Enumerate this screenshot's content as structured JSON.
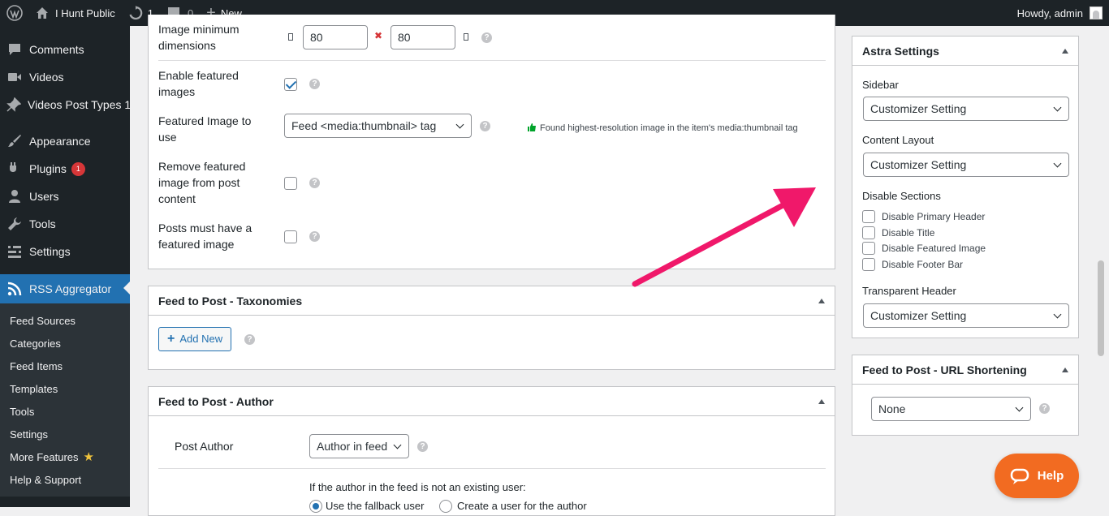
{
  "adminbar": {
    "site_name": "I Hunt Public",
    "updates_count": "1",
    "comments_count": "0",
    "new_label": "New",
    "howdy": "Howdy, admin"
  },
  "sidebar": {
    "items": [
      {
        "label": "Comments",
        "icon": "comment-icon"
      },
      {
        "label": "Videos",
        "icon": "video-icon"
      },
      {
        "label": "Videos Post Types 1",
        "icon": "pin-icon"
      },
      {
        "label": "Appearance",
        "icon": "brush-icon"
      },
      {
        "label": "Plugins",
        "icon": "plugin-icon",
        "badge": "1"
      },
      {
        "label": "Users",
        "icon": "user-icon"
      },
      {
        "label": "Tools",
        "icon": "wrench-icon"
      },
      {
        "label": "Settings",
        "icon": "settings-icon"
      },
      {
        "label": "RSS Aggregator",
        "icon": "rss-icon",
        "current": true
      }
    ],
    "submenu": [
      {
        "label": "Feed Sources"
      },
      {
        "label": "Categories"
      },
      {
        "label": "Feed Items"
      },
      {
        "label": "Templates"
      },
      {
        "label": "Tools"
      },
      {
        "label": "Settings"
      },
      {
        "label": "More Features",
        "star": "★"
      },
      {
        "label": "Help & Support"
      }
    ]
  },
  "images_panel": {
    "min_dims_label": "Image minimum dimensions",
    "min_width": "80",
    "times": "✖",
    "min_height": "80",
    "enable_featured_label": "Enable featured images",
    "enable_featured_checked": true,
    "featured_to_use_label": "Featured Image to use",
    "featured_to_use_value": "Feed <media:thumbnail> tag",
    "featured_note": "Found highest-resolution image in the item's media:thumbnail tag",
    "remove_featured_label": "Remove featured image from post content",
    "must_have_label": "Posts must have a featured image",
    "help_glyph": "?"
  },
  "taxonomies_panel": {
    "title": "Feed to Post - Taxonomies",
    "add_new": "Add New",
    "plus": "+"
  },
  "author_panel": {
    "title": "Feed to Post - Author",
    "post_author_label": "Post Author",
    "post_author_value": "Author in feed",
    "fallback_question": "If the author in the feed is not an existing user:",
    "radio_fallback": "Use the fallback user",
    "radio_create": "Create a user for the author"
  },
  "astra": {
    "title": "Astra Settings",
    "sidebar_label": "Sidebar",
    "sidebar_value": "Customizer Setting",
    "content_layout_label": "Content Layout",
    "content_layout_value": "Customizer Setting",
    "disable_sections_label": "Disable Sections",
    "sections": [
      {
        "label": "Disable Primary Header"
      },
      {
        "label": "Disable Title"
      },
      {
        "label": "Disable Featured Image"
      },
      {
        "label": "Disable Footer Bar"
      }
    ],
    "transparent_header_label": "Transparent Header",
    "transparent_header_value": "Customizer Setting"
  },
  "url_shortening": {
    "title": "Feed to Post - URL Shortening",
    "value": "None"
  },
  "help_widget": {
    "label": "Help"
  },
  "colors": {
    "accent": "#2271b1",
    "arrow": "#f0186a",
    "help_widget": "#f26b21"
  }
}
